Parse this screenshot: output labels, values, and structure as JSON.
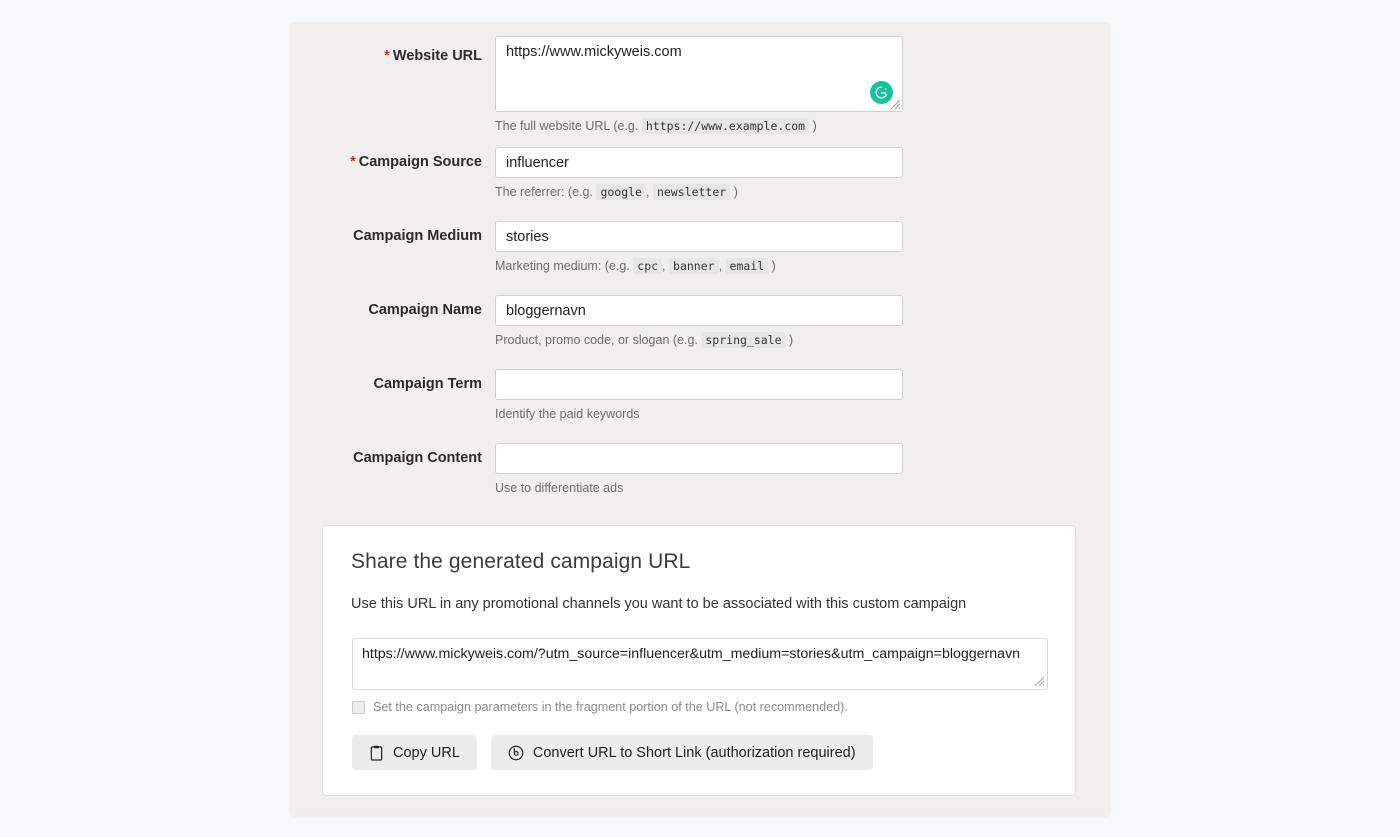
{
  "form": {
    "fields": [
      {
        "name": "website-url",
        "label": "Website URL",
        "required": true,
        "value": "https://www.mickyweis.com",
        "placeholder": "",
        "help_prefix": "The full website URL (e.g.",
        "help_chips": [
          "https://www.example.com"
        ],
        "help_suffix": ")",
        "badge": "grammarly-icon"
      },
      {
        "name": "campaign-source",
        "label": "Campaign Source",
        "required": true,
        "value": "influencer",
        "placeholder": "",
        "help_prefix": "The referrer: (e.g.",
        "help_chips": [
          "google",
          "newsletter"
        ],
        "help_suffix": ")"
      },
      {
        "name": "campaign-medium",
        "label": "Campaign Medium",
        "required": false,
        "value": "stories",
        "placeholder": "",
        "help_prefix": "Marketing medium: (e.g.",
        "help_chips": [
          "cpc",
          "banner",
          "email"
        ],
        "help_suffix": ")"
      },
      {
        "name": "campaign-name",
        "label": "Campaign Name",
        "required": false,
        "value": "bloggernavn",
        "placeholder": "",
        "help_prefix": "Product, promo code, or slogan (e.g.",
        "help_chips": [
          "spring_sale"
        ],
        "help_suffix": ")"
      },
      {
        "name": "campaign-term",
        "label": "Campaign Term",
        "required": false,
        "value": "",
        "placeholder": "",
        "help_prefix": "Identify the paid keywords",
        "help_chips": [],
        "help_suffix": ""
      },
      {
        "name": "campaign-content",
        "label": "Campaign Content",
        "required": false,
        "value": "",
        "placeholder": "",
        "help_prefix": "Use to differentiate ads",
        "help_chips": [],
        "help_suffix": ""
      }
    ]
  },
  "share": {
    "title": "Share the generated campaign URL",
    "subtitle": "Use this URL in any promotional channels you want to be associated with this custom campaign",
    "generated_url": "https://www.mickyweis.com/?utm_source=influencer&utm_medium=stories&utm_campaign=bloggernavn",
    "fragment_checkbox_label": "Set the campaign parameters in the fragment portion of the URL (not recommended).",
    "fragment_checked": false,
    "copy_button_label": "Copy URL",
    "copy_button_icon": "clipboard-icon",
    "shortlink_button_label": "Convert URL to Short Link (authorization required)",
    "shortlink_button_icon": "bitly-icon"
  },
  "colors": {
    "page_background": "#f7f8fa",
    "panel_background": "#f0efed",
    "card_background": "#ffffff",
    "required_star": "#c9302c",
    "grammarly_green": "#15c39a",
    "button_background": "#ececec",
    "help_text": "#6d6d6d"
  }
}
